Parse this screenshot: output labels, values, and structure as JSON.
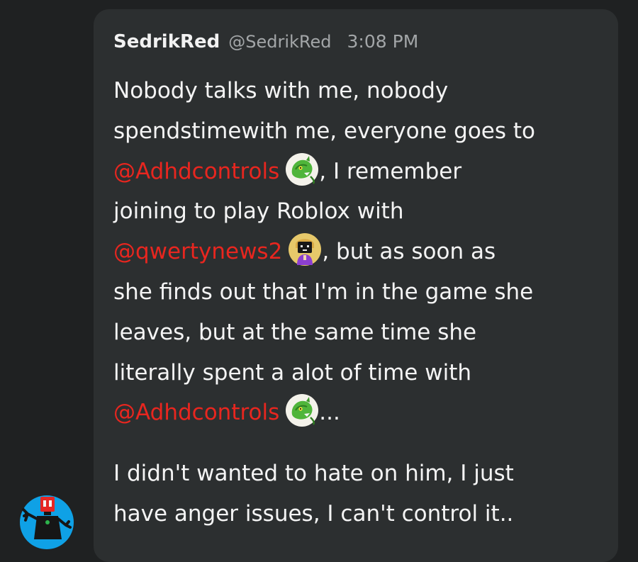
{
  "post": {
    "username": "SedrikRed",
    "handle": "@SedrikRed",
    "time": "3:08 PM",
    "lines": {
      "l1": "Nobody talks with me, nobody",
      "l2": "spendstimewith me, everyone goes to",
      "l3_mention": "@Adhdcontrols",
      "l3_after": ", I remember",
      "l4": "joining to play Roblox with",
      "l5_mention": "@qwertynews2",
      "l5_after": ", but as soon as",
      "l6": "she finds out that I'm in the game she",
      "l7": "leaves, but at the same time she",
      "l8": "literally spent a alot of time with",
      "l9_mention": "@Adhdcontrols",
      "l9_after": "...",
      "p2_l1": "I didn't wanted to hate on him, I just",
      "p2_l2": "have anger issues, I can't control it.."
    }
  },
  "icons": {
    "adhdcontrols_avatar": "green-dragon-avatar-icon",
    "qwertynews2_avatar": "cartoon-character-avatar-icon",
    "author_avatar": "red-headed-robot-avatar-icon"
  },
  "colors": {
    "background": "#1f2122",
    "bubble": "#2c2f30",
    "text": "#f4f4f4",
    "meta": "#a3a6a8",
    "mention": "#e8261f",
    "avatar_bg": "#0fa1e6"
  }
}
